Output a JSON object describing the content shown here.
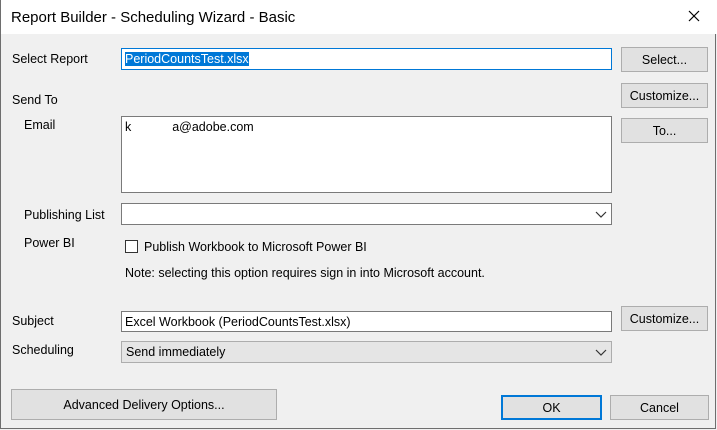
{
  "window": {
    "title": "Report Builder - Scheduling Wizard - Basic"
  },
  "icons": {
    "close": "close-icon",
    "chevron": "chevron-down-icon"
  },
  "colors": {
    "accent": "#0078d7",
    "selection": "#0078d7"
  },
  "report": {
    "label": "Select Report",
    "value": "PeriodCountsTest.xlsx",
    "select_button": "Select..."
  },
  "send_to": {
    "label": "Send To",
    "customize_button": "Customize..."
  },
  "email": {
    "label": "Email",
    "value_left": "k",
    "value_right": "a@adobe.com",
    "to_button": "To..."
  },
  "publishing_list": {
    "label": "Publishing List",
    "value": ""
  },
  "power_bi": {
    "label": "Power BI",
    "checkbox_label": "Publish Workbook to Microsoft Power BI",
    "checked": false,
    "note": "Note: selecting this option requires sign in into Microsoft account."
  },
  "subject": {
    "label": "Subject",
    "value": "Excel Workbook (PeriodCountsTest.xlsx)",
    "customize_button": "Customize..."
  },
  "scheduling": {
    "label": "Scheduling",
    "value": "Send immediately"
  },
  "footer": {
    "advanced_button": "Advanced Delivery Options...",
    "ok_button": "OK",
    "cancel_button": "Cancel"
  }
}
